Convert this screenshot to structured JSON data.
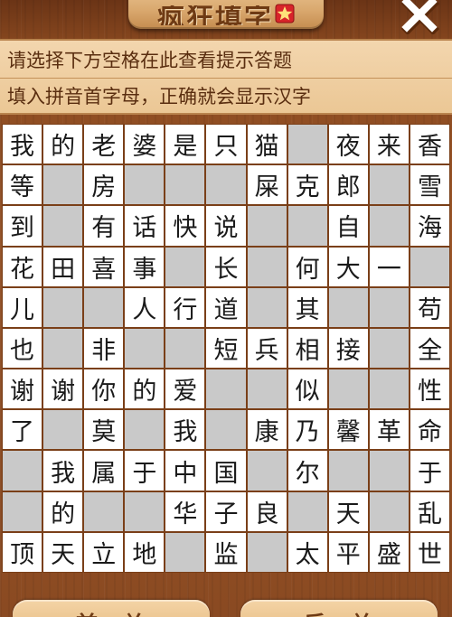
{
  "header": {
    "title": "疯狂填字",
    "close_icon": "close-icon",
    "badge_icon": "star-badge-icon",
    "accent": "#d8242a"
  },
  "hint": {
    "line1": "请选择下方空格在此查看提示答题",
    "line2": "填入拼音首字母，正确就会显示汉字"
  },
  "grid": {
    "rows": [
      [
        "我",
        "的",
        "老",
        "婆",
        "是",
        "只",
        "猫",
        "",
        "夜",
        "来",
        "香"
      ],
      [
        "等",
        "",
        "房",
        "",
        "",
        "",
        "屎",
        "克",
        "郎",
        "",
        "雪"
      ],
      [
        "到",
        "",
        "有",
        "话",
        "快",
        "说",
        "",
        "",
        "自",
        "",
        "海"
      ],
      [
        "花",
        "田",
        "喜",
        "事",
        "",
        "长",
        "",
        "何",
        "大",
        "一",
        ""
      ],
      [
        "儿",
        "",
        "",
        "人",
        "行",
        "道",
        "",
        "其",
        "",
        "",
        "苟"
      ],
      [
        "也",
        "",
        "非",
        "",
        "",
        "短",
        "兵",
        "相",
        "接",
        "",
        "全"
      ],
      [
        "谢",
        "谢",
        "你",
        "的",
        "爱",
        "",
        "",
        "似",
        "",
        "",
        "性"
      ],
      [
        "了",
        "",
        "莫",
        "",
        "我",
        "",
        "康",
        "乃",
        "馨",
        "革",
        "命"
      ],
      [
        "",
        "我",
        "属",
        "于",
        "中",
        "国",
        "",
        "尔",
        "",
        "",
        "于"
      ],
      [
        "",
        "的",
        "",
        "",
        "华",
        "子",
        "良",
        "",
        "天",
        "",
        "乱"
      ],
      [
        "顶",
        "天",
        "立",
        "地",
        "",
        "监",
        "",
        "太",
        "平",
        "盛",
        "世"
      ]
    ]
  },
  "footer": {
    "prev_label": "前一关",
    "next_label": "后一关"
  }
}
